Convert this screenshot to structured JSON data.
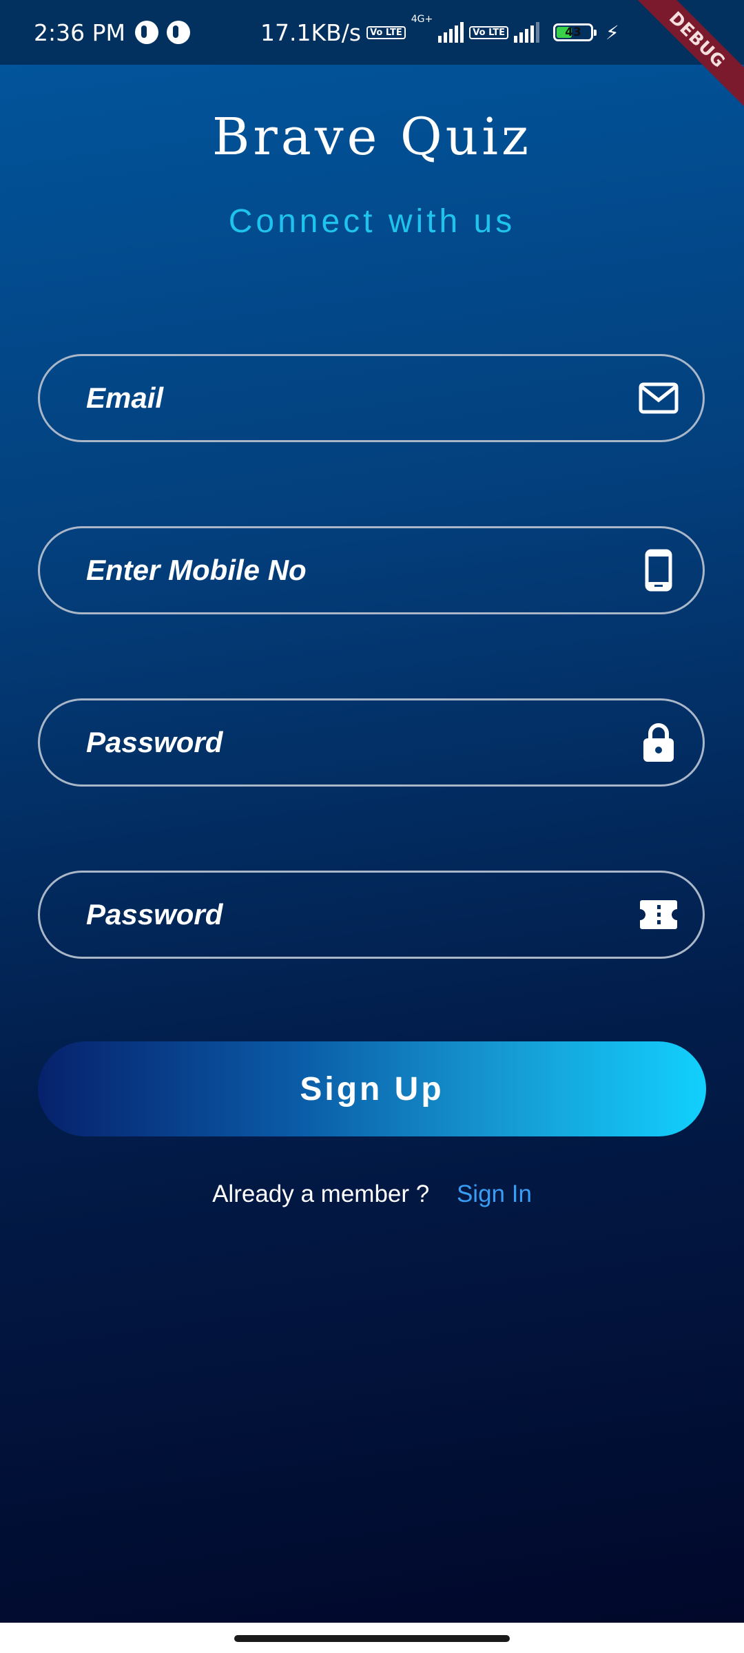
{
  "status_bar": {
    "time": "2:36 PM",
    "speed": "17.1KB/s",
    "volte": "Vo LTE",
    "network": "4G+",
    "battery": "43",
    "battery_level": 0.43
  },
  "debug_label": "DEBUG",
  "app": {
    "title": "Brave Quiz",
    "subtitle": "Connect with us"
  },
  "form": {
    "email_placeholder": "Email",
    "mobile_placeholder": "Enter Mobile No",
    "password_placeholder": "Password",
    "confirm_password_placeholder": "Password",
    "email_icon": "mail-icon",
    "mobile_icon": "phone-icon",
    "password_icon": "lock-icon",
    "confirm_icon": "ticket-icon"
  },
  "signup_label": "Sign Up",
  "footer": {
    "question": "Already a member ?",
    "signin_label": "Sign In"
  },
  "colors": {
    "accent": "#1ec4ee",
    "link": "#3a9df5",
    "gradient_start": "#07216c",
    "gradient_end": "#12d0fd"
  }
}
